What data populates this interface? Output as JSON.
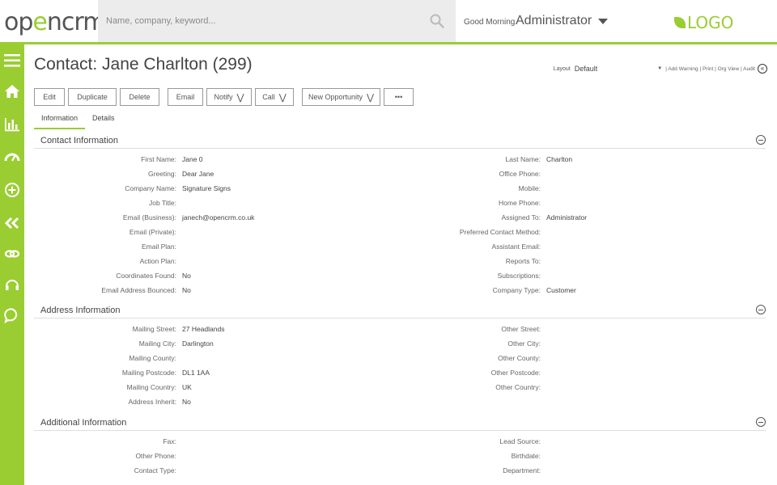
{
  "app": {
    "logo_prefix": "op",
    "logo_e": "e",
    "logo_suffix": "ncrm",
    "brand_logo": "LOGO",
    "accent": "#9acd32"
  },
  "header": {
    "search_placeholder": "Name, company, keyword...",
    "greeting": "Good Morning",
    "user": "Administrator"
  },
  "sidebar": {
    "icons": [
      "menu-icon",
      "home-icon",
      "chart-icon",
      "speedometer-icon",
      "plus-circle-icon",
      "double-chevron-left-icon",
      "link-icon",
      "headset-icon",
      "chat-icon"
    ]
  },
  "page": {
    "title": "Contact: Jane Charlton (299)",
    "layout_label": "Layout",
    "layout_value": "Default",
    "links": "| Add Warning | Print | Org View | Audit"
  },
  "toolbar": {
    "edit": "Edit",
    "duplicate": "Duplicate",
    "delete": "Delete",
    "email": "Email",
    "notify": "Notify",
    "call": "Call",
    "new_opportunity": "New Opportunity",
    "more": "•••"
  },
  "tabs": [
    "Information",
    "Details"
  ],
  "sections": {
    "contact": {
      "title": "Contact Information",
      "left": [
        {
          "label": "First Name:",
          "value": "Jane 0"
        },
        {
          "label": "Greeting:",
          "value": "Dear Jane"
        },
        {
          "label": "Company Name:",
          "value": "Signature Signs"
        },
        {
          "label": "Job Title:",
          "value": ""
        },
        {
          "label": "Email (Business):",
          "value": "janech@opencrm.co.uk"
        },
        {
          "label": "Email (Private):",
          "value": ""
        },
        {
          "label": "Email Plan:",
          "value": ""
        },
        {
          "label": "Action Plan:",
          "value": ""
        },
        {
          "label": "Coordinates Found:",
          "value": "No"
        },
        {
          "label": "Email Address Bounced:",
          "value": "No"
        }
      ],
      "right": [
        {
          "label": "Last Name:",
          "value": "Charlton"
        },
        {
          "label": "Office Phone:",
          "value": ""
        },
        {
          "label": "Mobile:",
          "value": ""
        },
        {
          "label": "Home Phone:",
          "value": ""
        },
        {
          "label": "Assigned To:",
          "value": "Administrator"
        },
        {
          "label": "Preferred Contact Method:",
          "value": ""
        },
        {
          "label": "Assistant Email:",
          "value": ""
        },
        {
          "label": "Reports To:",
          "value": ""
        },
        {
          "label": "Subscriptions:",
          "value": ""
        },
        {
          "label": "Company Type:",
          "value": "Customer"
        }
      ]
    },
    "address": {
      "title": "Address Information",
      "left": [
        {
          "label": "Mailing Street:",
          "value": "27 Headlands"
        },
        {
          "label": "Mailing City:",
          "value": "Darlington"
        },
        {
          "label": "Mailing County:",
          "value": ""
        },
        {
          "label": "Mailing Postcode:",
          "value": "DL1 1AA"
        },
        {
          "label": "Mailing Country:",
          "value": "UK"
        },
        {
          "label": "Address Inherit:",
          "value": "No"
        }
      ],
      "right": [
        {
          "label": "Other Street:",
          "value": ""
        },
        {
          "label": "Other City:",
          "value": ""
        },
        {
          "label": "Other County:",
          "value": ""
        },
        {
          "label": "Other Postcode:",
          "value": ""
        },
        {
          "label": "Other Country:",
          "value": ""
        }
      ]
    },
    "additional": {
      "title": "Additional Information",
      "left": [
        {
          "label": "Fax:",
          "value": ""
        },
        {
          "label": "Other Phone:",
          "value": ""
        },
        {
          "label": "Contact Type:",
          "value": ""
        }
      ],
      "right": [
        {
          "label": "Lead Source:",
          "value": ""
        },
        {
          "label": "Birthdate:",
          "value": ""
        },
        {
          "label": "Department:",
          "value": ""
        }
      ]
    }
  }
}
